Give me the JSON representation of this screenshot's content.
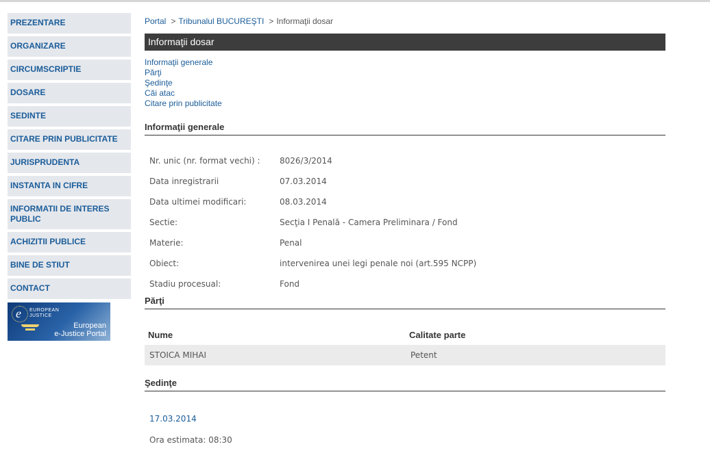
{
  "sidebar": {
    "items": [
      {
        "label": "PREZENTARE"
      },
      {
        "label": "ORGANIZARE"
      },
      {
        "label": "CIRCUMSCRIPTIE"
      },
      {
        "label": "DOSARE"
      },
      {
        "label": "SEDINTE"
      },
      {
        "label": "CITARE PRIN PUBLICITATE"
      },
      {
        "label": "JURISPRUDENTA"
      },
      {
        "label": "INSTANTA IN CIFRE"
      },
      {
        "label": "INFORMATII DE INTERES PUBLIC"
      },
      {
        "label": "ACHIZITII PUBLICE"
      },
      {
        "label": "BINE DE STIUT"
      },
      {
        "label": "CONTACT"
      }
    ],
    "banner": {
      "logo_letter": "e",
      "line1": "EUROPEAN",
      "line2": "JUSTICE",
      "title1": "European",
      "title2": "e-Justice Portal"
    }
  },
  "breadcrumb": {
    "home": "Portal",
    "sep": ">",
    "court": "Tribunalul BUCUREŞTI",
    "current": "Informaţii dosar"
  },
  "page_title": "Informaţii dosar",
  "anchors": [
    "Informaţii generale",
    "Părţi",
    "Şedinţe",
    "Căi atac",
    "Citare prin publicitate"
  ],
  "general": {
    "heading": "Informaţii generale",
    "rows": [
      {
        "label": "Nr. unic (nr. format vechi) :",
        "value": "8026/3/2014"
      },
      {
        "label": "Data inregistrarii",
        "value": "07.03.2014"
      },
      {
        "label": "Data ultimei modificari:",
        "value": "08.03.2014"
      },
      {
        "label": "Sectie:",
        "value": "Secţia I Penală - Camera Preliminara / Fond"
      },
      {
        "label": "Materie:",
        "value": "Penal"
      },
      {
        "label": "Obiect:",
        "value": "intervenirea unei legi penale noi (art.595 NCPP)"
      },
      {
        "label": "Stadiu procesual:",
        "value": "Fond"
      }
    ]
  },
  "parti": {
    "heading": "Părţi",
    "col_name": "Nume",
    "col_role": "Calitate parte",
    "rows": [
      {
        "name": "STOICA MIHAI",
        "role": "Petent"
      }
    ]
  },
  "sedinte": {
    "heading": "Şedinţe",
    "date": "17.03.2014",
    "ora": "Ora estimata: 08:30"
  }
}
